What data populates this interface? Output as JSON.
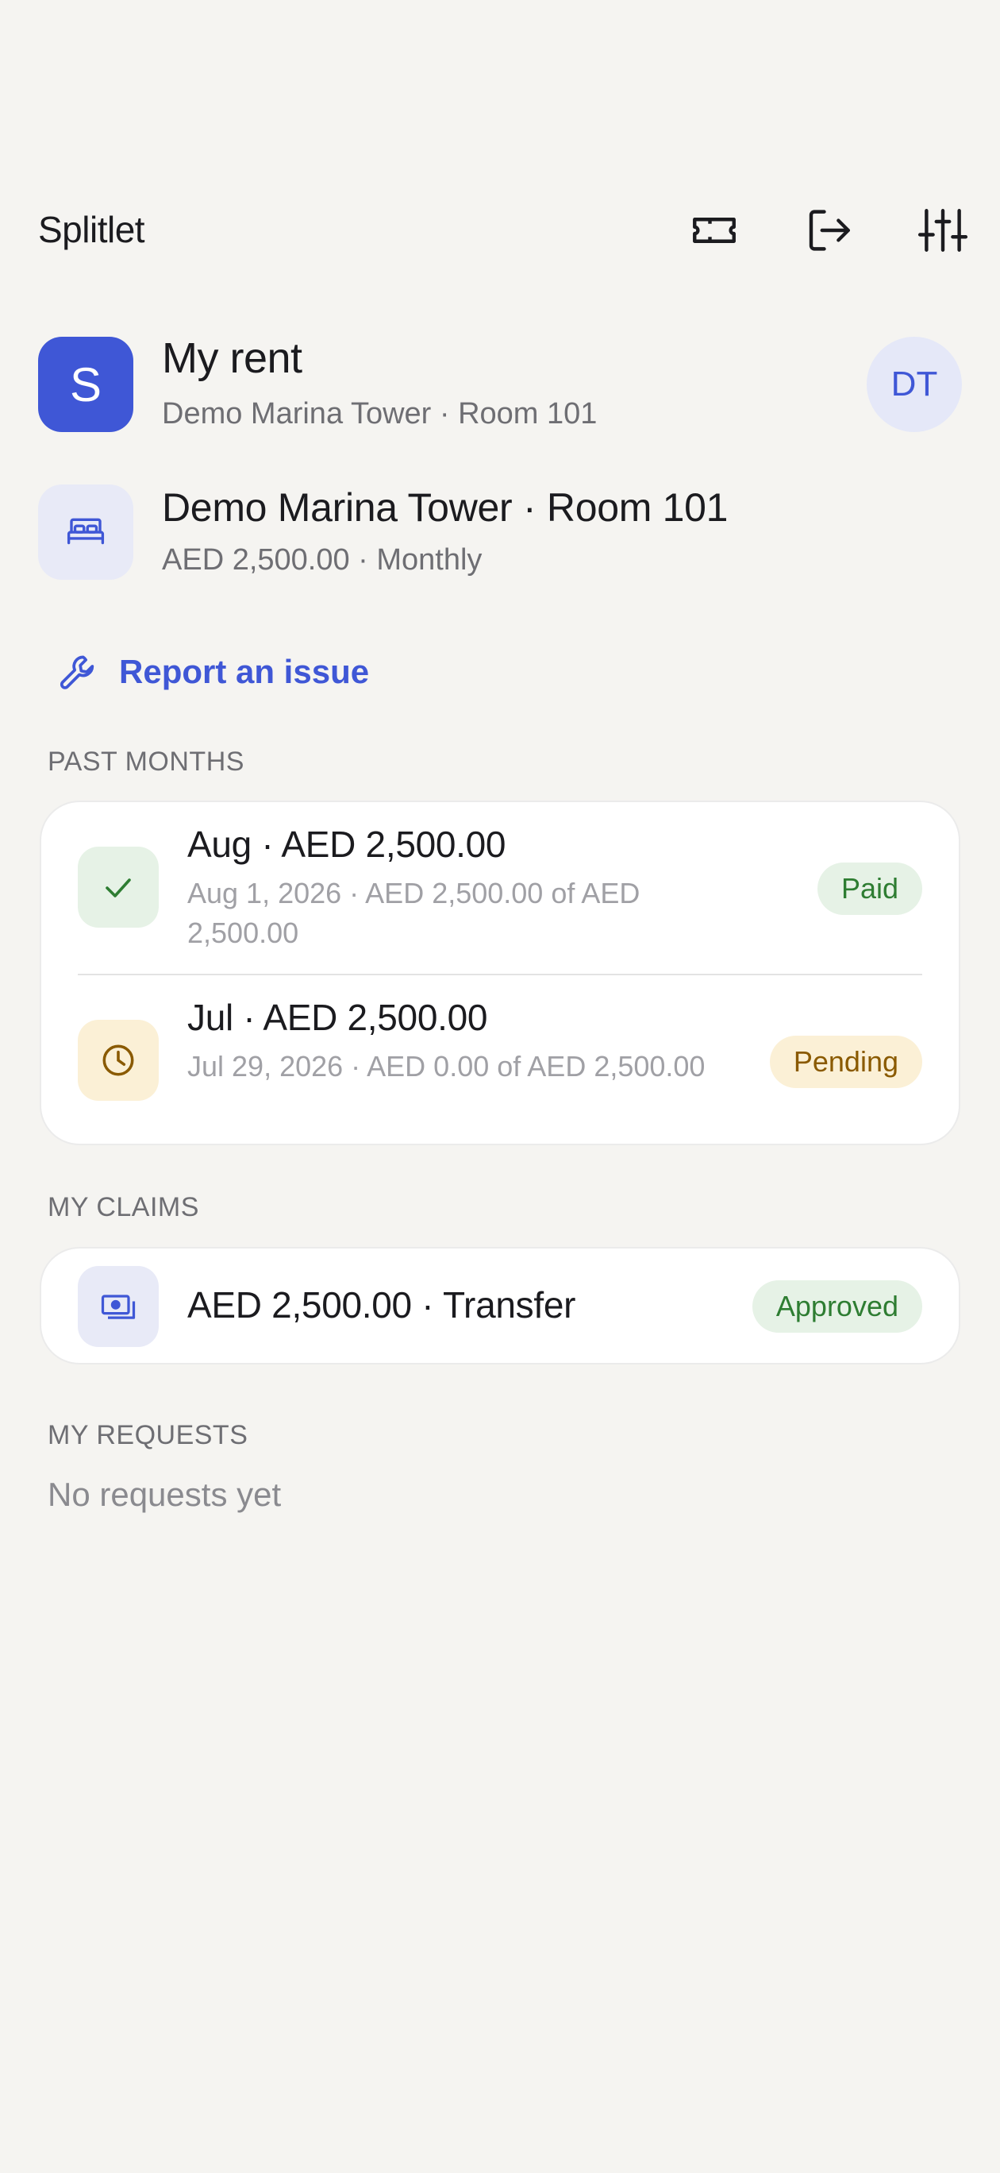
{
  "app": {
    "title": "Splitlet"
  },
  "toolbar": {
    "icons": [
      "ticket-icon",
      "logout-icon",
      "sliders-icon"
    ]
  },
  "header": {
    "avatar_letter": "S",
    "title": "My rent",
    "subtitle": "Demo Marina Tower · Room 101",
    "user_initials": "DT"
  },
  "property": {
    "title": "Demo Marina Tower · Room 101",
    "subtitle": "AED 2,500.00 · Monthly"
  },
  "report": {
    "label": "Report an issue"
  },
  "past_months": {
    "label": "PAST MONTHS",
    "items": [
      {
        "title": "Aug · AED 2,500.00",
        "subtitle": "Aug 1, 2026 · AED 2,500.00 of AED 2,500.00",
        "status": "Paid",
        "icon": "check-icon"
      },
      {
        "title": "Jul · AED 2,500.00",
        "subtitle": "Jul 29, 2026 · AED 0.00 of AED 2,500.00",
        "status": "Pending",
        "icon": "clock-icon"
      }
    ]
  },
  "claims": {
    "label": "MY CLAIMS",
    "items": [
      {
        "title": "AED 2,500.00 · Transfer",
        "status": "Approved",
        "icon": "cash-icon"
      }
    ]
  },
  "requests": {
    "label": "MY REQUESTS",
    "empty": "No requests yet"
  },
  "colors": {
    "accent": "#3f57d6",
    "background": "#f5f4f1",
    "paid_bg": "#e6f2e6",
    "paid_fg": "#2e7d32",
    "pending_bg": "#fbf0d6",
    "pending_fg": "#8a5a00"
  }
}
